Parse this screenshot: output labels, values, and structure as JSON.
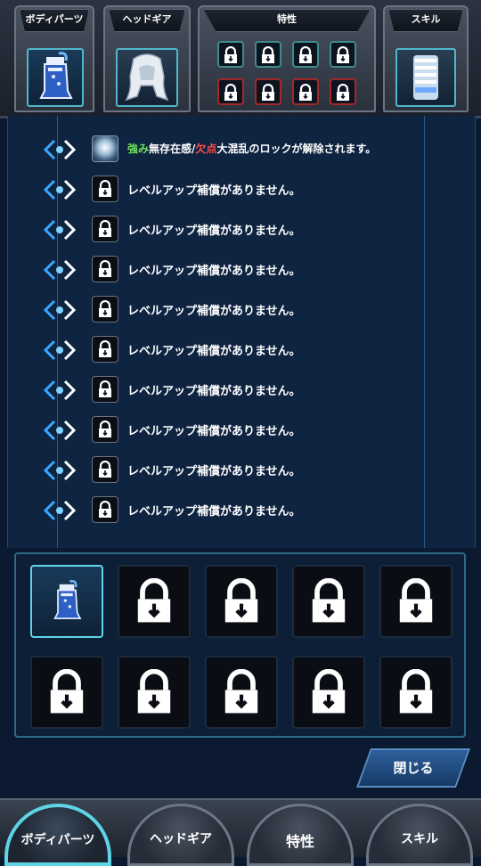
{
  "slots": {
    "body_parts": "ボディパーツ",
    "head_gear": "ヘッドギア",
    "traits": "特性",
    "skill": "スキル"
  },
  "rows": [
    {
      "strength_label": "強み",
      "strength": "無存在感",
      "separator": "/",
      "weakness_label": "欠点",
      "weakness": "大混乱",
      "suffix": "のロックが解除されます。",
      "icon": "orb-icon"
    },
    {
      "text": "レベルアップ補償がありません。",
      "icon": "lock-icon"
    },
    {
      "text": "レベルアップ補償がありません。",
      "icon": "lock-icon"
    },
    {
      "text": "レベルアップ補償がありません。",
      "icon": "lock-icon"
    },
    {
      "text": "レベルアップ補償がありません。",
      "icon": "lock-icon"
    },
    {
      "text": "レベルアップ補償がありません。",
      "icon": "lock-icon"
    },
    {
      "text": "レベルアップ補償がありません。",
      "icon": "lock-icon"
    },
    {
      "text": "レベルアップ補償がありません。",
      "icon": "lock-icon"
    },
    {
      "text": "レベルアップ補償がありません。",
      "icon": "lock-icon"
    },
    {
      "text": "レベルアップ補償がありません。",
      "icon": "lock-icon"
    }
  ],
  "close_label": "閉じる",
  "tabs": [
    "ボディパーツ",
    "ヘッドギア",
    "特性",
    "スキル"
  ],
  "colors": {
    "strength": "#6fe25a",
    "weakness": "#ff4a4a",
    "accent": "#5fd4e6"
  }
}
